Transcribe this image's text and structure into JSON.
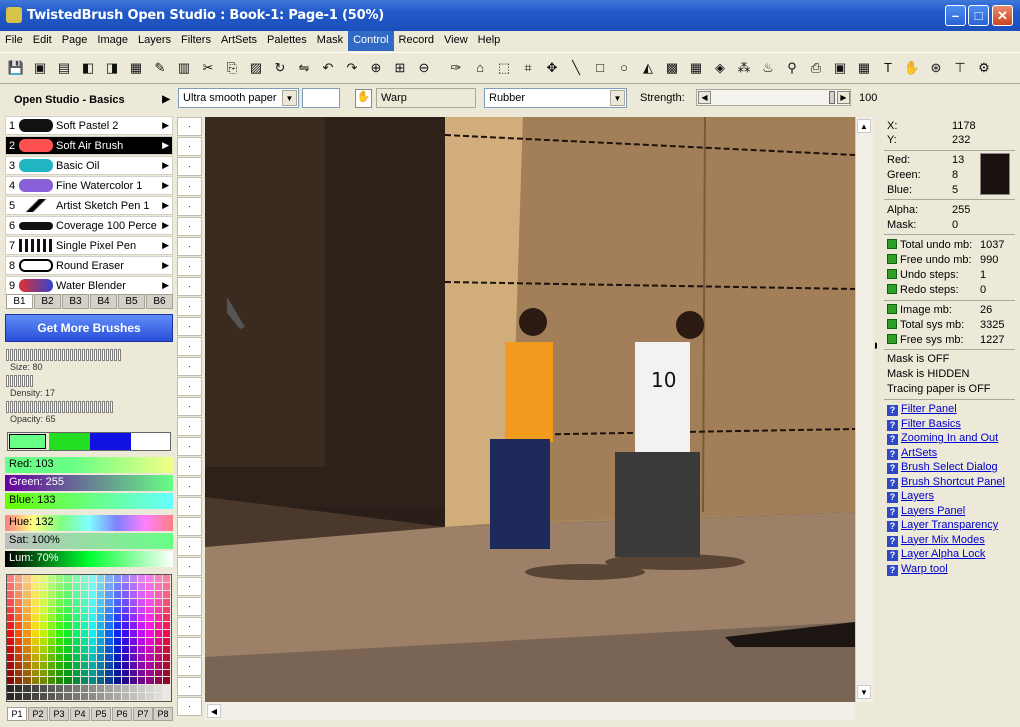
{
  "window": {
    "title": "TwistedBrush Open Studio : Book-1: Page-1 (50%)"
  },
  "menu": [
    "File",
    "Edit",
    "Page",
    "Image",
    "Layers",
    "Filters",
    "ArtSets",
    "Palettes",
    "Mask",
    "Control",
    "Record",
    "View",
    "Help"
  ],
  "menu_active": "Control",
  "options": {
    "paper": "Ultra smooth paper",
    "tool_label": "Warp",
    "mode": "Rubber",
    "strength_label": "Strength:",
    "strength_value": "100",
    "strength_level": 1.0
  },
  "left": {
    "set_title": "Open Studio - Basics",
    "brushes": [
      {
        "num": "1",
        "name": "Soft Pastel 2",
        "color": "#111111"
      },
      {
        "num": "2",
        "name": "Soft Air Brush",
        "color": "#ff5050"
      },
      {
        "num": "3",
        "name": "Basic Oil",
        "color": "#22b5c4"
      },
      {
        "num": "4",
        "name": "Fine Watercolor 1",
        "color": "#8a60d8"
      },
      {
        "num": "5",
        "name": "Artist Sketch Pen 1",
        "color": "#000000"
      },
      {
        "num": "6",
        "name": "Coverage 100 Perce",
        "color": "#111111"
      },
      {
        "num": "7",
        "name": "Single Pixel Pen",
        "color": "#111111"
      },
      {
        "num": "8",
        "name": "Round Eraser",
        "color": "#ffffff"
      },
      {
        "num": "9",
        "name": "Water Blender",
        "color": "#3344d0"
      }
    ],
    "brush_tabs": [
      "B1",
      "B2",
      "B3",
      "B4",
      "B5",
      "B6"
    ],
    "get_more": "Get More Brushes",
    "size_label": "Size: 80",
    "density_label": "Density: 17",
    "opacity_label": "Opacity: 65",
    "colors": {
      "red": "Red: 103",
      "green": "Green: 255",
      "blue": "Blue: 133",
      "hue": "Hue: 132",
      "sat": "Sat: 100%",
      "lum": "Lum: 70%"
    },
    "palette_tabs": [
      "P1",
      "P2",
      "P3",
      "P4",
      "P5",
      "P6",
      "P7",
      "P8"
    ]
  },
  "right": {
    "x_label": "X:",
    "x": "1178",
    "y_label": "Y:",
    "y": "232",
    "red_label": "Red:",
    "red": "13",
    "green_label": "Green:",
    "green": "8",
    "blue_label": "Blue:",
    "blue": "5",
    "swatch": "#1b1010",
    "alpha_label": "Alpha:",
    "alpha": "255",
    "mask_label": "Mask:",
    "mask": "0",
    "stats": [
      {
        "label": "Total undo mb:",
        "value": "1037"
      },
      {
        "label": "Free undo mb:",
        "value": "990"
      },
      {
        "label": "Undo steps:",
        "value": "1"
      },
      {
        "label": "Redo steps:",
        "value": "0"
      }
    ],
    "mem": [
      {
        "label": "Image mb:",
        "value": "26"
      },
      {
        "label": "Total sys mb:",
        "value": "3325"
      },
      {
        "label": "Free sys mb:",
        "value": "1227"
      }
    ],
    "status": [
      "Mask is OFF",
      "Mask is HIDDEN",
      "Tracing paper is OFF"
    ],
    "links": [
      "Filter Panel",
      "Filter Basics",
      "Zooming In and Out",
      "ArtSets",
      "Brush Select Dialog",
      "Brush Shortcut Panel",
      "Layers",
      "Layers Panel",
      "Layer Transparency",
      "Layer Mix Modes",
      "Layer Alpha Lock",
      "Warp tool"
    ]
  }
}
